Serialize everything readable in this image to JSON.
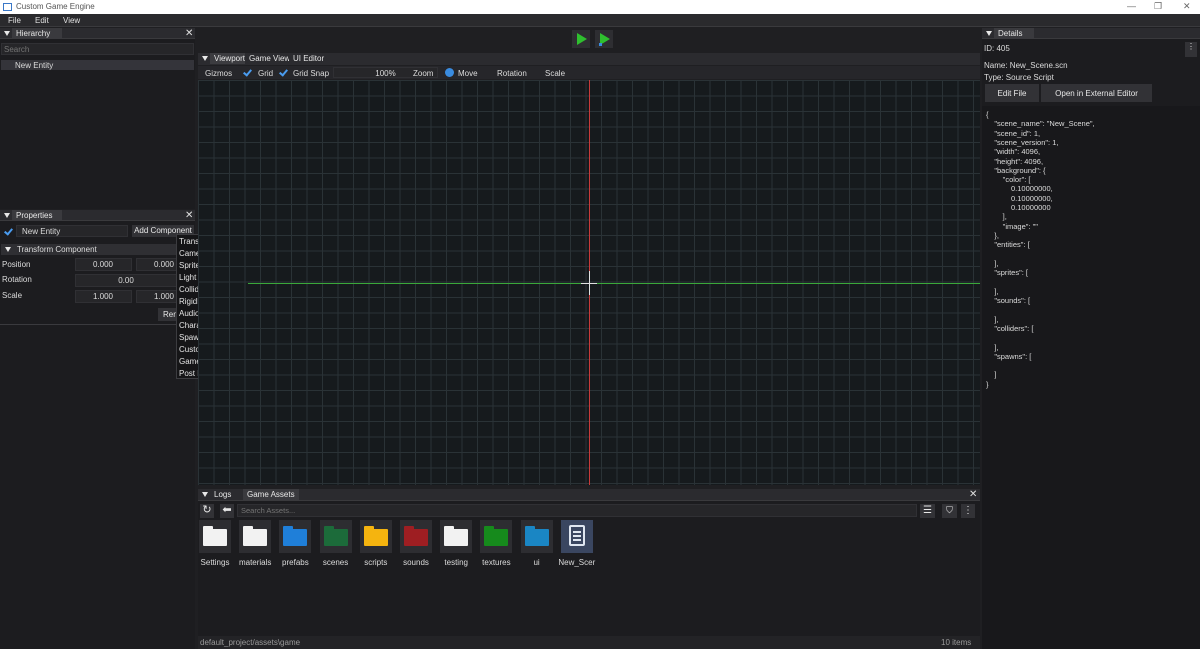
{
  "window": {
    "title": "Custom Game Engine",
    "minimize_glyph": "—",
    "maximize_glyph": "❐",
    "close_glyph": "✕"
  },
  "menu": {
    "file": "File",
    "edit": "Edit",
    "view": "View"
  },
  "hierarchy": {
    "title": "Hierarchy",
    "search_placeholder": "Search",
    "items": [
      "New Entity"
    ]
  },
  "properties": {
    "title": "Properties",
    "entity_name": "New Entity",
    "add_component": "Add Component",
    "component_title": "Transform Component",
    "position_label": "Position",
    "position": [
      "0.000",
      "0.000"
    ],
    "rotation_label": "Rotation",
    "rotation": "0.00",
    "scale_label": "Scale",
    "scale": [
      "1.000",
      "1.000"
    ],
    "remove": "Rem"
  },
  "component_menu": [
    "Transform",
    "Camera",
    "Sprite",
    "Light",
    "Collider",
    "RigidBody",
    "Audio",
    "Character",
    "Spawn",
    "Custom Tag",
    "Game Manager",
    "Post Processing"
  ],
  "viewport": {
    "tabs": [
      "Viewport",
      "Game View",
      "UI Editor"
    ],
    "toolbar": {
      "gizmos": "Gizmos",
      "grid": "Grid",
      "grid_snap": "Grid Snap",
      "zoom_value": "100%",
      "zoom_label": "Zoom",
      "move": "Move",
      "rotation": "Rotation",
      "scale": "Scale"
    },
    "colors": {
      "x_axis": "#c83a3a",
      "y_axis": "#3aa83a",
      "grid": "#2a3236",
      "play": "#2fbf2f"
    }
  },
  "details": {
    "title": "Details",
    "id": "ID: 405",
    "name": "Name: New_Scene.scn",
    "type": "Type: Source Script",
    "edit_file": "Edit File",
    "open_external": "Open in External Editor",
    "json_lines": [
      "{",
      "    \"scene_name\": \"New_Scene\",",
      "    \"scene_id\": 1,",
      "    \"scene_version\": 1,",
      "    \"width\": 4096,",
      "    \"height\": 4096,",
      "    \"background\": {",
      "        \"color\": [",
      "            0.10000000,",
      "            0.10000000,",
      "            0.10000000",
      "        ],",
      "        \"image\": \"\"",
      "    },",
      "    \"entities\": [",
      "",
      "    ],",
      "    \"sprites\": [",
      "",
      "    ],",
      "    \"sounds\": [",
      "",
      "    ],",
      "    \"colliders\": [",
      "",
      "    ],",
      "    \"spawns\": [",
      "",
      "    ]",
      "}"
    ]
  },
  "bottom": {
    "tabs": [
      "Logs",
      "Game Assets"
    ],
    "search_placeholder": "Search Assets...",
    "assets": [
      {
        "name": "Settings",
        "color": "#f2f2f2",
        "icon": "folder-icon"
      },
      {
        "name": "materials",
        "color": "#f2f2f2",
        "icon": "folder-icon"
      },
      {
        "name": "prefabs",
        "color": "#1f7fd9",
        "icon": "folder-icon"
      },
      {
        "name": "scenes",
        "color": "#1c6b3a",
        "icon": "folder-icon"
      },
      {
        "name": "scripts",
        "color": "#f5b40f",
        "icon": "folder-icon"
      },
      {
        "name": "sounds",
        "color": "#9e1e22",
        "icon": "folder-icon"
      },
      {
        "name": "testing",
        "color": "#f2f2f2",
        "icon": "folder-icon"
      },
      {
        "name": "textures",
        "color": "#168a1c",
        "icon": "folder-icon"
      },
      {
        "name": "ui",
        "color": "#1a86c4",
        "icon": "folder-icon"
      },
      {
        "name": "New_Scer",
        "color": "#dfe6f0",
        "icon": "document-icon"
      }
    ],
    "path": "default_project/assets\\game",
    "count": "10 items"
  }
}
